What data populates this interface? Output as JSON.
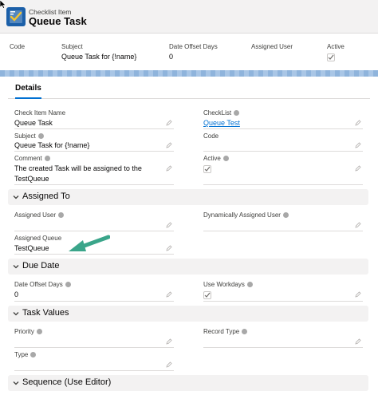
{
  "header": {
    "object_label": "Checklist Item",
    "record_title": "Queue Task"
  },
  "highlights": {
    "code_label": "Code",
    "subject_label": "Subject",
    "subject_value": "Queue Task for {!name}",
    "date_offset_label": "Date Offset Days",
    "date_offset_value": "0",
    "assigned_user_label": "Assigned User",
    "active_label": "Active",
    "active_checked": true
  },
  "tabs": {
    "details": "Details"
  },
  "details": {
    "check_item_name_label": "Check Item Name",
    "check_item_name_value": "Queue Task",
    "checklist_label": "CheckList",
    "checklist_value": "Queue Test",
    "subject_label": "Subject",
    "subject_value": "Queue Task for {!name}",
    "code_label": "Code",
    "comment_label": "Comment",
    "comment_line1": "The created Task will be assigned to the",
    "comment_line2": "TestQueue",
    "active_label": "Active",
    "active_checked": true
  },
  "assigned_to": {
    "title": "Assigned To",
    "assigned_user_label": "Assigned User",
    "dynamic_user_label": "Dynamically Assigned User",
    "assigned_queue_label": "Assigned Queue",
    "assigned_queue_value": "TestQueue"
  },
  "due_date": {
    "title": "Due Date",
    "date_offset_label": "Date Offset Days",
    "date_offset_value": "0",
    "use_workdays_label": "Use Workdays",
    "use_workdays_checked": true
  },
  "task_values": {
    "title": "Task Values",
    "priority_label": "Priority",
    "record_type_label": "Record Type",
    "type_label": "Type"
  },
  "sequence": {
    "title": "Sequence (Use Editor)"
  },
  "colors": {
    "link": "#0070d2",
    "section_bg": "#f3f2f2",
    "arrow": "#3aa58a",
    "app_icon": "#1b5fa8"
  }
}
